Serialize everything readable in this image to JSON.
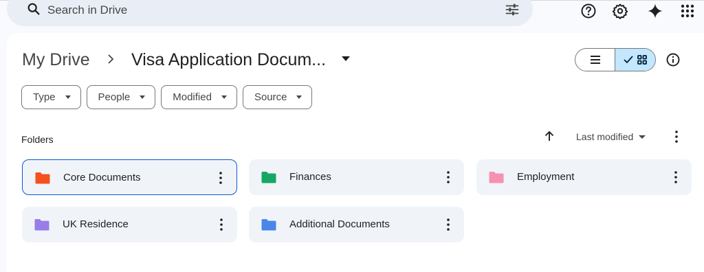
{
  "search": {
    "placeholder": "Search in Drive"
  },
  "breadcrumb": {
    "root": "My Drive",
    "current": "Visa Application Docum..."
  },
  "filters": [
    {
      "label": "Type"
    },
    {
      "label": "People"
    },
    {
      "label": "Modified"
    },
    {
      "label": "Source"
    }
  ],
  "section": {
    "title": "Folders",
    "sort_label": "Last modified"
  },
  "folders": [
    {
      "name": "Core Documents",
      "color": "#f4511e",
      "selected": true
    },
    {
      "name": "Finances",
      "color": "#16a765",
      "selected": false
    },
    {
      "name": "Employment",
      "color": "#f691b2",
      "selected": false
    },
    {
      "name": "UK Residence",
      "color": "#9a7ee8",
      "selected": false
    },
    {
      "name": "Additional Documents",
      "color": "#4a86e8",
      "selected": false
    }
  ],
  "icons": {
    "search": "search-icon",
    "tune": "tune-icon",
    "help": "help-icon",
    "settings": "settings-icon",
    "gemini": "gemini-sparkle-icon",
    "apps": "apps-grid-icon",
    "list_view": "list-view-icon",
    "grid_view": "grid-view-icon",
    "info": "info-icon"
  },
  "colors": {
    "accent": "#0b57d0",
    "toggle_selected": "#c2e7ff",
    "surface": "#f0f4f9"
  }
}
